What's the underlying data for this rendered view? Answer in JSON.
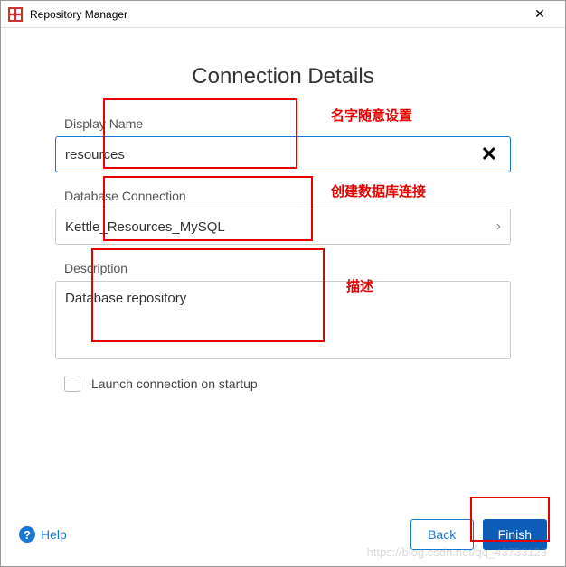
{
  "window": {
    "title": "Repository Manager"
  },
  "heading": "Connection Details",
  "fields": {
    "displayName": {
      "label": "Display Name",
      "value": "resources"
    },
    "dbConnection": {
      "label": "Database Connection",
      "value": "Kettle_Resources_MySQL"
    },
    "description": {
      "label": "Description",
      "value": "Database repository"
    },
    "launchOnStartup": {
      "label": "Launch connection on startup",
      "checked": false
    }
  },
  "footer": {
    "help": "Help",
    "back": "Back",
    "finish": "Finish"
  },
  "annotations": {
    "name": "名字随意设置",
    "db": "创建数据库连接",
    "desc": "描述"
  },
  "watermark": "https://blog.csdn.net/qq_43733123"
}
